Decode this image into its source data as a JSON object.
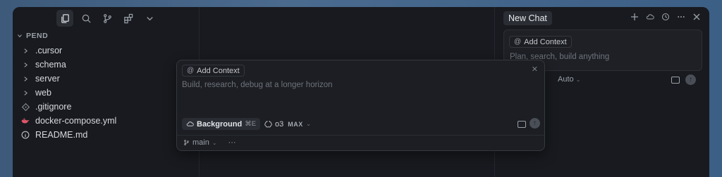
{
  "sidebar": {
    "section_title": "PEND",
    "items": [
      {
        "label": ".cursor",
        "type": "folder"
      },
      {
        "label": "schema",
        "type": "folder"
      },
      {
        "label": "server",
        "type": "folder"
      },
      {
        "label": "web",
        "type": "folder"
      },
      {
        "label": ".gitignore",
        "type": "file-git"
      },
      {
        "label": "docker-compose.yml",
        "type": "file-docker"
      },
      {
        "label": "README.md",
        "type": "file-info"
      }
    ]
  },
  "chat": {
    "tab_label": "New Chat",
    "add_context": "Add Context",
    "placeholder": "Plan, search, build anything",
    "mode": "Auto"
  },
  "composer": {
    "add_context": "Add Context",
    "placeholder": "Build, research, debug at a longer horizon",
    "background_label": "Background",
    "background_shortcut": "⌘E",
    "model": "o3",
    "model_badge": "MAX",
    "branch": "main",
    "more": "···"
  },
  "colors": {
    "background": "#181a1f",
    "accent_desktop": "#4a6a8e"
  }
}
